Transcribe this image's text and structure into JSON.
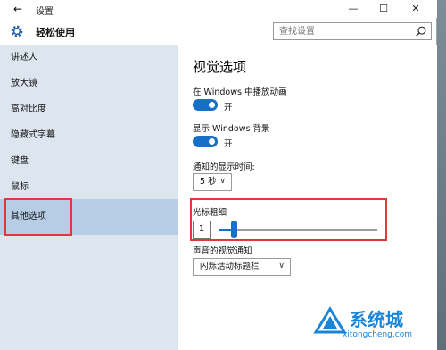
{
  "titlebar": {
    "back": "←",
    "title": "设置",
    "minimize": "—",
    "maximize": "☐",
    "close": "✕"
  },
  "header": {
    "title": "轻松使用",
    "search_placeholder": "查找设置"
  },
  "sidebar": {
    "items": [
      {
        "label": "讲述人"
      },
      {
        "label": "放大镜"
      },
      {
        "label": "高对比度"
      },
      {
        "label": "隐藏式字幕"
      },
      {
        "label": "键盘"
      },
      {
        "label": "鼠标"
      },
      {
        "label": "其他选项",
        "selected": true
      }
    ]
  },
  "content": {
    "title": "视觉选项",
    "play_animations_label": "在 Windows 中播放动画",
    "play_animations_state": "开",
    "show_background_label": "显示 Windows 背景",
    "show_background_state": "开",
    "notify_time_label": "通知的显示时间:",
    "notify_time_value": "5 秒",
    "cursor_thickness_label": "光标粗细",
    "cursor_thickness_value": "1",
    "visual_notify_label": "声音的视觉通知",
    "visual_notify_value": "闪烁活动标题栏"
  },
  "watermark": {
    "text": "系统城",
    "url": "xitongcheng.com"
  },
  "colors": {
    "accent": "#1670c8",
    "sidebar_bg": "#dde6ef",
    "selected_bg": "#b7cde6",
    "highlight": "#e0393b"
  }
}
